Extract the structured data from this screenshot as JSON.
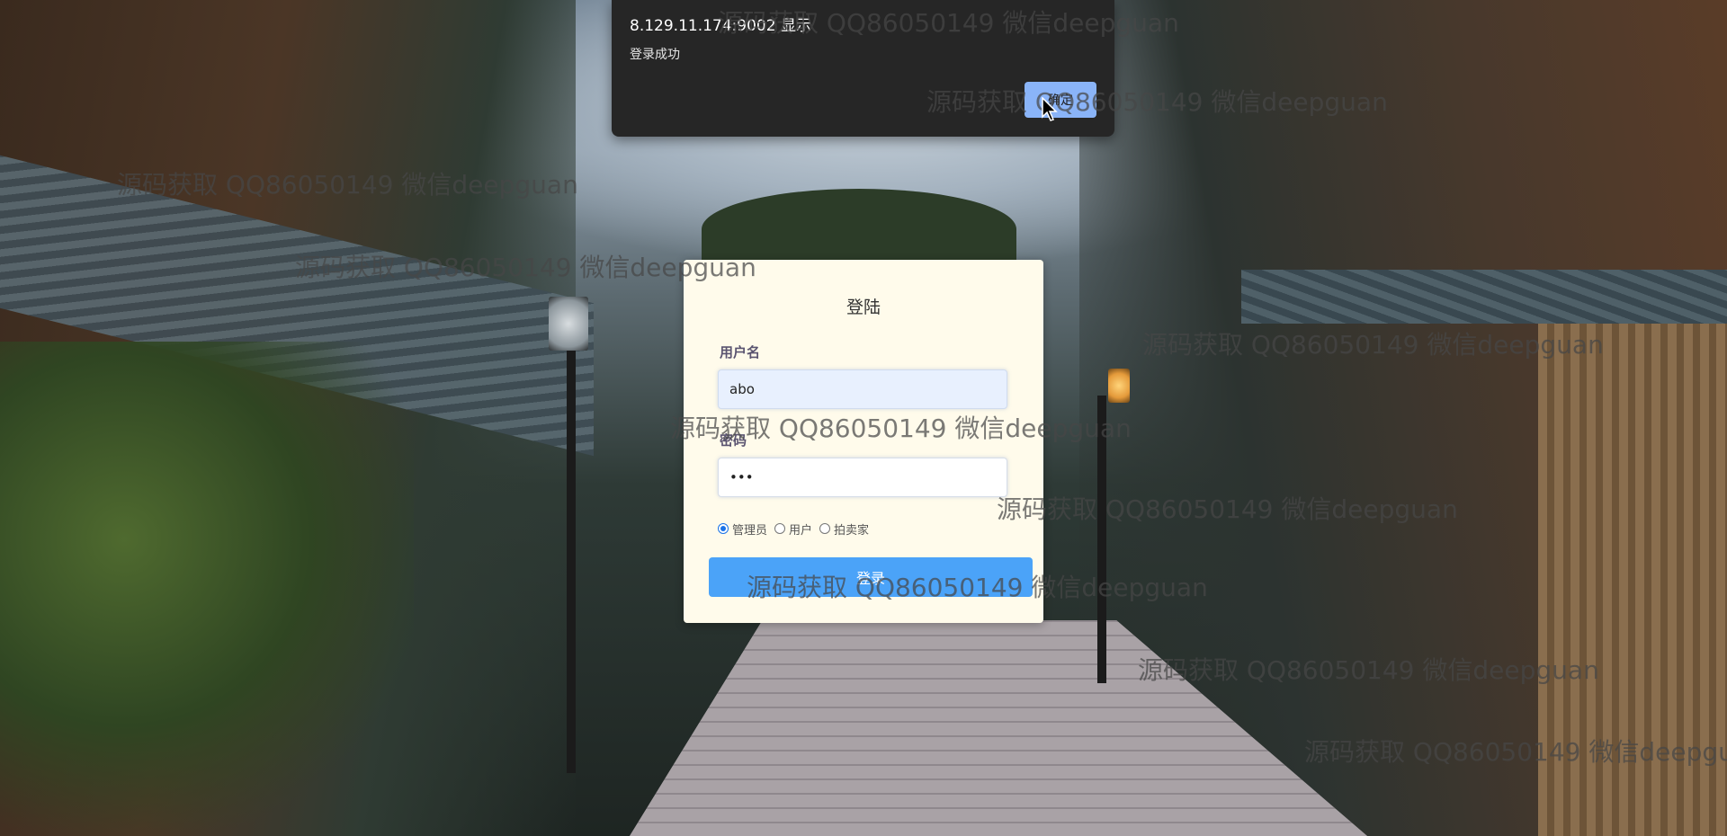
{
  "alert": {
    "title": "8.129.11.174:9002 显示",
    "message": "登录成功",
    "ok_label": "确定"
  },
  "login": {
    "title": "登陆",
    "username_label": "用户名",
    "username_value": "abo",
    "password_label": "密码",
    "password_value": "abc",
    "roles": [
      {
        "label": "管理员",
        "checked": true
      },
      {
        "label": "用户",
        "checked": false
      },
      {
        "label": "拍卖家",
        "checked": false
      }
    ],
    "submit_label": "登录"
  },
  "watermarks": [
    "源码获取 QQ86050149 微信deepguan",
    "源码获取 QQ86050149 微信deepguan",
    "源码获取 QQ86050149 微信deepguan",
    "源码获取 QQ86050149 微信deepguan",
    "源码获取 QQ86050149 微信deepguan",
    "源码获取 QQ86050149 微信deepguan",
    "源码获取 QQ86050149 微信deepguan",
    "源码获取 QQ86050149 微信deepguan",
    "源码获取 QQ86050149 微信deepguan",
    "源码获取 QQ86050149 微信deepguan"
  ],
  "colors": {
    "card_bg": "#fffbeb",
    "button_bg": "#4ba3f8",
    "alert_bg": "#262626",
    "alert_ok_bg": "#8ab4f8",
    "radio_accent": "#1a73e8"
  }
}
